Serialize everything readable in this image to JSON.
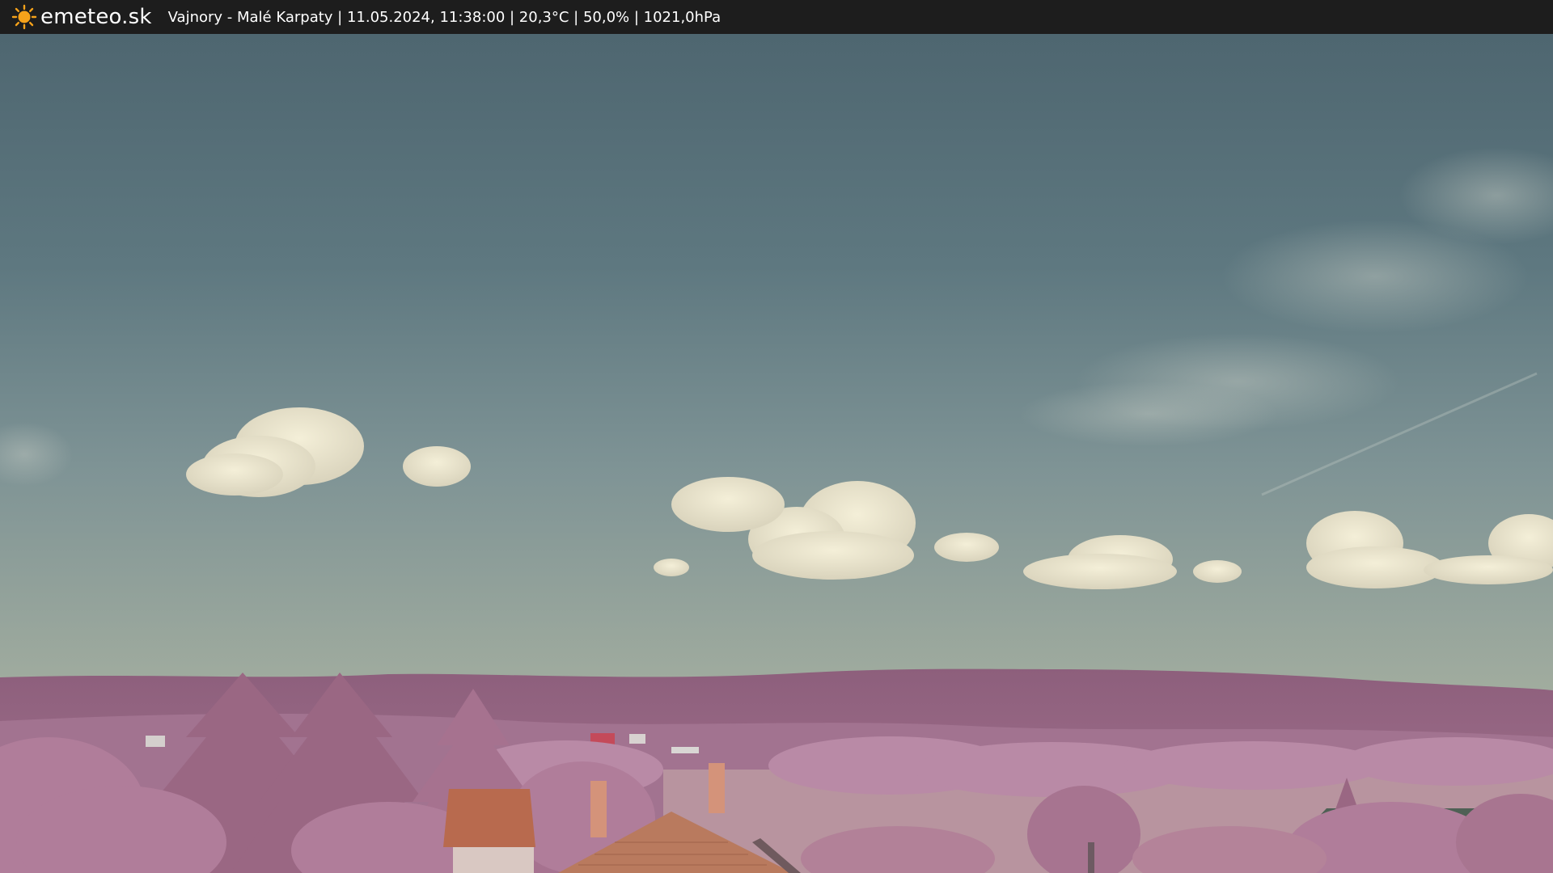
{
  "brand": {
    "logo_text": "emeteo.sk",
    "logo_icon": "sun-icon"
  },
  "overlay": {
    "caption": "Vajnory - Malé Karpaty | 11.05.2024, 11:38:00 | 20,3°C | 50,0% | 1021,0hPa"
  },
  "colors": {
    "bar_bg": "#1d1d1d",
    "sun": "#f6a21a",
    "sky_top": "#4e6670",
    "sky_horizon": "#9aa8a0",
    "foliage": "#b07d9a",
    "roof": "#b86a4e"
  }
}
